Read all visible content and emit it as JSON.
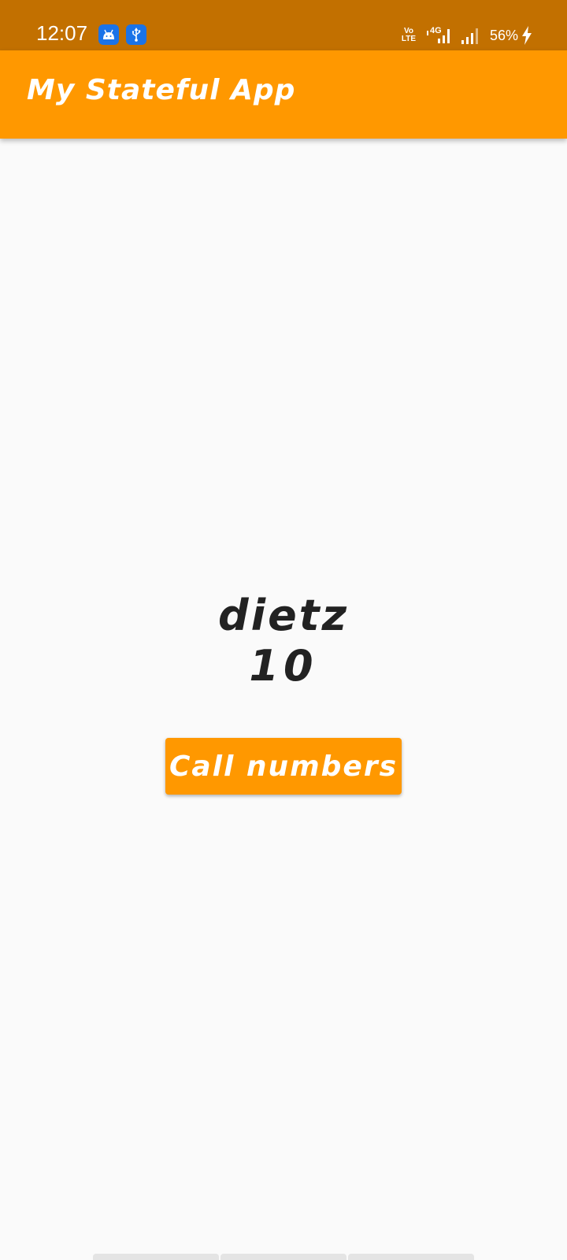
{
  "status_bar": {
    "time": "12:07",
    "volte_line1": "Vo",
    "volte_line2": "LTE",
    "network_type": "4G",
    "battery_percent": "56%",
    "icons": [
      "android-notification-icon",
      "usb-notification-icon",
      "volte-icon",
      "signal-4g-icon",
      "signal-icon",
      "battery-charging-icon"
    ],
    "background_color": "#c27000"
  },
  "app_bar": {
    "title": "My Stateful App",
    "background_color": "#ff9800"
  },
  "main": {
    "word": "dietz",
    "number": "10",
    "button_label": "Call numbers",
    "accent_color": "#ff9800"
  }
}
